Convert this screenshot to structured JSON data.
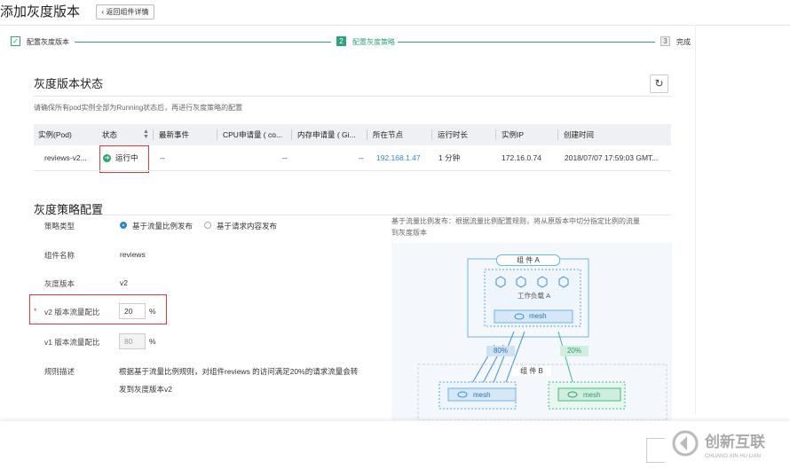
{
  "page": {
    "title": "添加灰度版本",
    "back_label": "返回组件详情"
  },
  "steps": [
    {
      "num": "✓",
      "label": "配置灰度版本"
    },
    {
      "num": "2",
      "label": "配置灰度策略"
    },
    {
      "num": "3",
      "label": "完成"
    }
  ],
  "status_section": {
    "title": "灰度版本状态",
    "hint": "请确保所有pod实例全部为Running状态后，再进行灰度策略的配置",
    "columns": [
      "实例(Pod)",
      "状态",
      "最新事件",
      "CPU申请量 ( co...",
      "内存申请量 ( Gi...",
      "所在节点",
      "运行时长",
      "实例IP",
      "创建时间"
    ],
    "row": {
      "pod": "reviews-v2...",
      "status": "运行中",
      "event": "--",
      "cpu": "--",
      "mem": "--",
      "node": "192.168.1.47",
      "uptime": "1 分钟",
      "ip": "172.16.0.74",
      "created": "2018/07/07 17:59:03 GMT..."
    }
  },
  "strategy_section": {
    "title": "灰度策略配置",
    "type_label": "策略类型",
    "type_options": [
      "基于流量比例发布",
      "基于请求内容发布"
    ],
    "component_label": "组件名称",
    "component_value": "reviews",
    "version_label": "灰度版本",
    "version_value": "v2",
    "v2_label": "v2 版本流量配比",
    "v2_value": "20",
    "v1_label": "v1 版本流量配比",
    "v1_value": "80",
    "percent": "%",
    "rule_label": "规则描述",
    "rule_text_line1": "根据基于流量比例规则，对组件reviews 的访问满足20%的请求流量会转",
    "rule_text_line2": "发到灰度版本v2",
    "diagram_desc_line1": "基于流量比例发布：根据流量比例配置规则，将从原版本中切分指定比例的流量",
    "diagram_desc_line2": "到灰度版本"
  },
  "diagram": {
    "group_a": "组 件 A",
    "workload_a": "工作负载 A",
    "mesh": "mesh",
    "pct_80": "80%",
    "pct_20": "20%",
    "group_b": "组 件 B"
  },
  "colors": {
    "accent": "#2ea37a",
    "link": "#2f86d6",
    "highlight": "#e03a3a"
  }
}
